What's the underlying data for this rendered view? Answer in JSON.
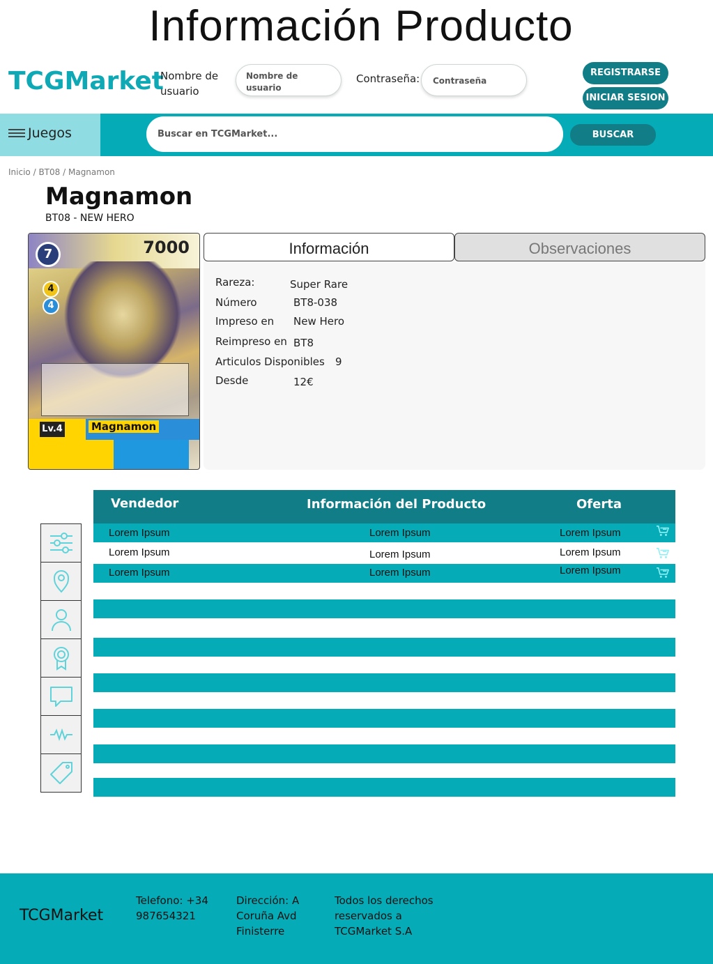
{
  "page_title": "Información Producto",
  "header": {
    "logo": "TCGMarket",
    "username_label": "Nombre de usuario",
    "username_placeholder": "Nombre de usuario",
    "password_label": "Contraseña:",
    "password_placeholder": "Contraseña",
    "register_label": "REGISTRARSE",
    "login_label": "INICIAR SESION"
  },
  "navbar": {
    "games_label": "Juegos",
    "search_placeholder": "Buscar en TCGMarket...",
    "search_button": "BUSCAR"
  },
  "breadcrumb": [
    "Inicio",
    "BT08",
    "Magnamon"
  ],
  "product": {
    "name": "Magnamon",
    "set": "BT08 - NEW HERO",
    "card": {
      "play_cost": "7",
      "dp": "7000",
      "evo_cost_1": "4",
      "evo_cost_2": "4",
      "level": "Lv.4",
      "name": "Magnamon"
    }
  },
  "tabs": {
    "info": "Información",
    "observations": "Observaciones"
  },
  "info": {
    "rarity_label": "Rareza:",
    "rarity_value": "Super Rare",
    "number_label": "Número",
    "number_value": "BT8-038",
    "printed_label": "Impreso en",
    "printed_value": "New Hero",
    "reprint_label": "Reimpreso en",
    "reprint_value": "BT8",
    "available_label": "Articulos Disponibles",
    "available_value": "9",
    "from_label": "Desde",
    "from_value": "12€"
  },
  "offers_table": {
    "headers": [
      "Vendedor",
      "Información del Producto",
      "Oferta"
    ],
    "rows": [
      [
        "Lorem Ipsum",
        "Lorem Ipsum",
        "Lorem Ipsum"
      ],
      [
        "Lorem Ipsum",
        "Lorem Ipsum",
        "Lorem Ipsum"
      ],
      [
        "Lorem Ipsum",
        "Lorem Ipsum",
        "Lorem Ipsum"
      ]
    ]
  },
  "side_icons": [
    "filter-sliders-icon",
    "location-pin-icon",
    "user-icon",
    "award-icon",
    "chat-icon",
    "activity-icon",
    "tag-icon"
  ],
  "colors": {
    "teal": "#05abb6",
    "dark_teal": "#117d86",
    "light_teal": "#8fdde2"
  },
  "footer": {
    "brand": "TCGMarket",
    "phone": "Telefono: +34 987654321",
    "address": "Dirección: A Coruña Avd Finisterre",
    "rights": "Todos los derechos reservados a TCGMarket S.A"
  }
}
